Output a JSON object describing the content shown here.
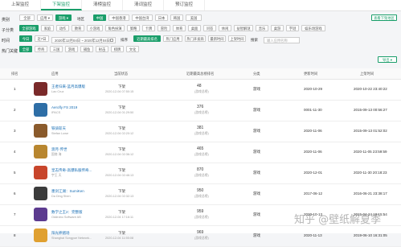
{
  "tabs": [
    {
      "label": "上架监控"
    },
    {
      "label": "下架监控",
      "active": true
    },
    {
      "label": "清榜监控"
    },
    {
      "label": "清词监控"
    },
    {
      "label": "预订监控"
    }
  ],
  "filters": {
    "category": {
      "label": "类别",
      "chips": [
        "全部",
        "应用 ▾",
        "游戏 ▾"
      ],
      "active_index": 2,
      "region_label": "地区",
      "regions": [
        "中国",
        "中国香港",
        "中国台湾",
        "日本",
        "韩国",
        "美国"
      ],
      "region_active_index": 0,
      "region_button": "查看下架地区"
    },
    "subcategory": {
      "label": "子分类",
      "chips": [
        "全部游戏",
        "家庭",
        "动作",
        "教育",
        "小游戏",
        "角色扮演",
        "策略",
        "卡牌",
        "冒险",
        "体育",
        "桌面",
        "问答",
        "休闲",
        "益智解谜",
        "音乐",
        "桌游",
        "字谜",
        "娱乐场游戏"
      ],
      "active_index": 0
    },
    "time": {
      "label": "时间",
      "chips": [
        "今日",
        "近7日"
      ],
      "active_index": 0,
      "date_range": "2020年12月04日 ~ 2020年12月04日",
      "date_icon": "calendar-icon",
      "sort_label": "排序",
      "sort_options": [
        "近期最高排名",
        "热门应用",
        "热门开发商",
        "最新时间",
        "上架时间"
      ],
      "sort_active_index": 0,
      "search_label": "搜索",
      "search_placeholder": "输入应用名称"
    },
    "hotwords": {
      "label": "热门关键",
      "chips": [
        "全部",
        "传奇",
        "三国",
        "游戏",
        "捕鱼",
        "射击",
        "棋牌",
        "文化"
      ],
      "active_index": 0
    },
    "export_label": "导出 ▾"
  },
  "table": {
    "headers": [
      "排名",
      "应用",
      "当前状态",
      "近期最高总榜排名",
      "分类",
      "更新时间",
      "上架时间"
    ],
    "rows": [
      {
        "rank": "1",
        "name": "王者归来-蓝月高爆版",
        "developer": "Lao Cruz",
        "status": "下架",
        "time": "2020-12-04 07:50:15",
        "best": "48",
        "best_sub": "(游戏总榜)",
        "category": "游戏",
        "updated": "2020-10-29",
        "listed": "2020-10-22 23:40:22",
        "color": "#7a2a2a"
      },
      {
        "rank": "2",
        "name": "Aerofly FS 2019",
        "developer": "IPACS",
        "status": "下架",
        "time": "2020-12-04 01:29:50",
        "best": "376",
        "best_sub": "(游戏总榜)",
        "category": "游戏",
        "updated": "0001-11-30",
        "listed": "2015-09-13 00:56:27",
        "color": "#2e6ea6"
      },
      {
        "rank": "3",
        "name": "铁骑斩天",
        "developer": "Stefan Lowe",
        "status": "下架",
        "time": "2020-12-04 02:20:12",
        "best": "381",
        "best_sub": "(游戏总榜)",
        "category": "游戏",
        "updated": "2020-11-06",
        "listed": "2015-09-13 01:52:02",
        "color": "#8a5a2b"
      },
      {
        "rank": "4",
        "name": "渡月·传世",
        "developer": "国商 海",
        "status": "下架",
        "time": "2020-12-04 02:36:12",
        "best": "465",
        "best_sub": "(游戏总榜)",
        "category": "游戏",
        "updated": "2020-11-06",
        "listed": "2020-11-05 23:59:59",
        "color": "#b8862f"
      },
      {
        "rank": "5",
        "name": "皇志传奇-高爆私服传奇...",
        "developer": "宇王 天",
        "status": "下架",
        "time": "2020-12-04 02:46:13",
        "best": "870",
        "best_sub": "(游戏总榜)",
        "category": "游戏",
        "updated": "2020-12-01",
        "listed": "2020-11-30 20:18:23",
        "color": "#c8452b"
      },
      {
        "rank": "6",
        "name": "墨剑江湖：SumiKen",
        "developer": "Da Ding Shen",
        "status": "下架",
        "time": "2020-12-04 02:32:13",
        "best": "950",
        "best_sub": "(游戏总榜)",
        "category": "游戏",
        "updated": "2017-06-12",
        "listed": "2016-06-21 23:38:17",
        "color": "#3b3b3b"
      },
      {
        "rank": "7",
        "name": "数学之王2：完整版",
        "developer": "Oddrobo Software AB",
        "status": "下架",
        "time": "2020-12-04 17:16:11",
        "best": "959",
        "best_sub": "(游戏总榜)",
        "category": "游戏",
        "updated": "2020-10-13",
        "listed": "2015-04-24 19:15:54",
        "color": "#5c3b8f"
      },
      {
        "rank": "8",
        "name": "阳光养猪场",
        "developer": "Shanghai Songyue Network...",
        "status": "下架",
        "time": "2020-12-04 11:55:08",
        "best": "969",
        "best_sub": "(游戏总榜)",
        "category": "游戏",
        "updated": "2020-11-13",
        "listed": "2019-06-10 16:31:05",
        "color": "#e0a030"
      }
    ]
  },
  "watermark": "知乎 @壁纸解夏季"
}
